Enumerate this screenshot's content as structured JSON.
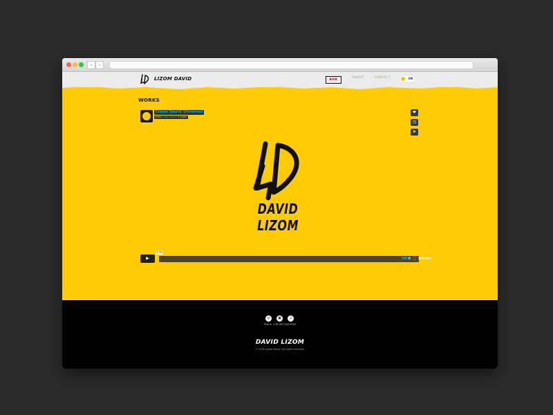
{
  "browser": {
    "back_label": "‹",
    "forward_label": "›"
  },
  "header": {
    "logo_text": "LIZOM DAVID",
    "nav": {
      "active_label": "АНК",
      "about_label": "ABOUT",
      "contact_label": "CONTACT"
    },
    "language": "EN"
  },
  "works": {
    "title": "WORKS",
    "video": {
      "title": "Lizom David Showreel",
      "byline_prefix": "from ",
      "byline_author": "Lizom David",
      "byline_suffix": " 3 years",
      "name_mark": "DAVID LIZOM",
      "timecode": "1:36",
      "progress_fraction": 0.01,
      "like_icon": "❤",
      "later_icon": "◷",
      "share_icon": "➤",
      "play_icon": "▶",
      "hd_label": "HD",
      "settings_icon": "⚙",
      "fullscreen_icon": "⛶",
      "vimeo_label": "vimeo"
    }
  },
  "footer": {
    "social": [
      "◎",
      "▣",
      "♫"
    ],
    "phone": "Phone: +38 067 000 0000",
    "logo_text": "DAVID LIZOM",
    "copyright": "© 2018 Lizom David. All rights reserved."
  },
  "colors": {
    "brand_yellow": "#ffcb05",
    "footer_black": "#000000",
    "vimeo_blue": "#00adef"
  }
}
